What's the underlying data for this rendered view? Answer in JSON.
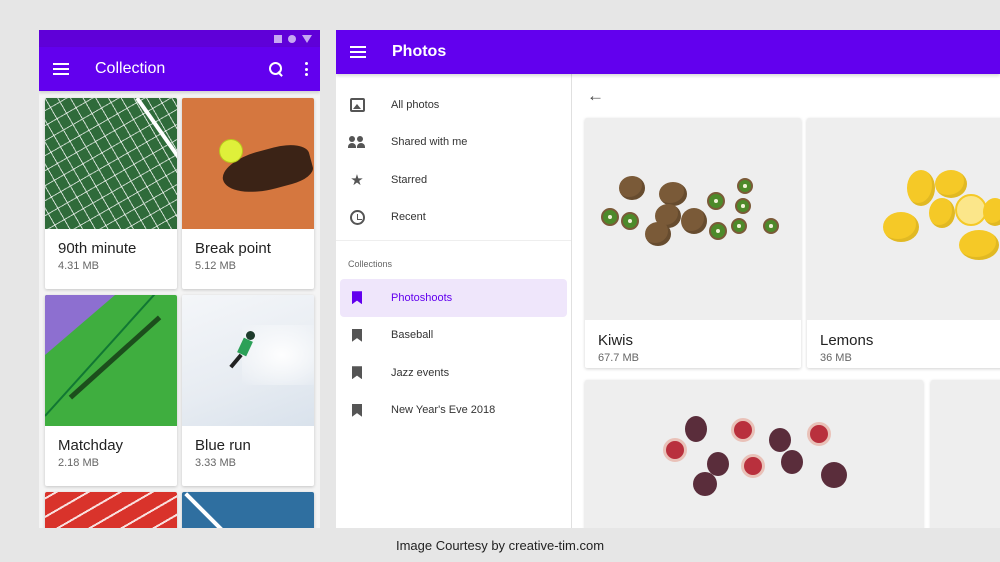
{
  "mobile": {
    "title": "Collection",
    "cards": [
      {
        "name": "90th minute",
        "size": "4.31 MB"
      },
      {
        "name": "Break point",
        "size": "5.12 MB"
      },
      {
        "name": "Matchday",
        "size": "2.18 MB"
      },
      {
        "name": "Blue run",
        "size": "3.33 MB"
      }
    ]
  },
  "desktop": {
    "title": "Photos",
    "nav": [
      {
        "label": "All photos",
        "icon": "photo-library-icon"
      },
      {
        "label": "Shared with me",
        "icon": "people-icon"
      },
      {
        "label": "Starred",
        "icon": "star-icon"
      },
      {
        "label": "Recent",
        "icon": "clock-icon"
      }
    ],
    "collections_header": "Collections",
    "collections": [
      {
        "label": "Photoshoots",
        "active": true
      },
      {
        "label": "Baseball"
      },
      {
        "label": "Jazz events"
      },
      {
        "label": "New Year's Eve 2018"
      }
    ],
    "cards": [
      {
        "name": "Kiwis",
        "size": "67.7 MB"
      },
      {
        "name": "Lemons",
        "size": "36 MB"
      }
    ]
  },
  "colors": {
    "primary": "#6200ee",
    "status_bar": "#5f00d8",
    "active_bg": "#efe6fb"
  },
  "caption": "Image Courtesy by creative-tim.com"
}
